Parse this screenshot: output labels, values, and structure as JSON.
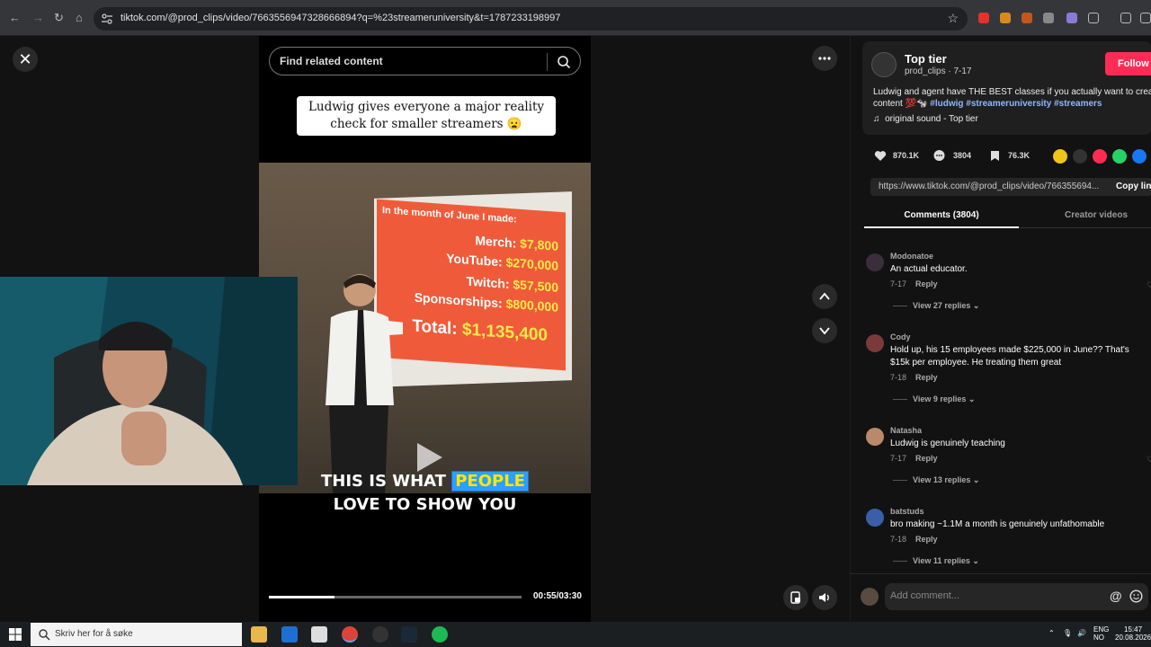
{
  "browser": {
    "url": "tiktok.com/@prod_clips/video/7663556947328666894?q=%23streameruniversity&t=1787233198997"
  },
  "search": {
    "placeholder": "Find related content"
  },
  "video": {
    "headline_line1": "Ludwig gives everyone a major reality",
    "headline_line2": "check for smaller streamers 😦",
    "slide": {
      "title": "In the month of June I made:",
      "lines": [
        {
          "label": "Merch:",
          "value": "$7,800"
        },
        {
          "label": "YouTube:",
          "value": "$270,000"
        },
        {
          "label": "Twitch:",
          "value": "$57,500"
        },
        {
          "label": "Sponsorships:",
          "value": "$800,000"
        },
        {
          "label": "Total:",
          "value": "$1,135,400"
        }
      ]
    },
    "caption_pre": "THIS IS WHAT",
    "caption_highlight": "PEOPLE",
    "caption_line2": "LOVE TO SHOW YOU",
    "time": "00:55/03:30",
    "progress": 0.26
  },
  "post": {
    "author": "Top tier",
    "handle_date": "prod_clips · 7-17",
    "follow": "Follow",
    "description": "Ludwig and agent have THE BEST classes if you actually want to create content 💯🐄",
    "tags": "#ludwig #streameruniversity #streamers",
    "sound": "original sound - Top tier",
    "likes": "870.1K",
    "comments_count": "3804",
    "saves": "76.3K",
    "link": "https://www.tiktok.com/@prod_clips/video/766355694...",
    "copy_link": "Copy link"
  },
  "tabs": {
    "comments": "Comments (3804)",
    "creator": "Creator videos"
  },
  "comments": [
    {
      "name": "Modonatoe",
      "text": "An actual educator.",
      "date": "7-17",
      "reply": "Reply",
      "replies": "View 27 replies"
    },
    {
      "name": "Cody",
      "text": "Hold up, his 15 employees made $225,000 in June?? That's $15k per employee. He treating them great",
      "date": "7-18",
      "reply": "Reply",
      "replies": "View 9 replies"
    },
    {
      "name": "Natasha",
      "text": "Ludwig is genuinely teaching",
      "date": "7-17",
      "reply": "Reply",
      "replies": "View 13 replies"
    },
    {
      "name": "batstuds",
      "text": "bro making ~1.1M a month is genuinely unfathomable",
      "date": "7-18",
      "reply": "Reply",
      "replies": "View 11 replies"
    }
  ],
  "add_comment": {
    "placeholder": "Add comment..."
  },
  "taskbar": {
    "search_placeholder": "Skriv her for å søke",
    "lang1": "ENG",
    "lang2": "NO",
    "time": "15:47",
    "date": "20.08.2026"
  },
  "colors": {
    "follow": "#fe2c55",
    "tag": "#8fb8ff",
    "slide": "#ef5b3a",
    "caption_highlight": "#2aa0ff"
  },
  "icons": [
    "close-icon",
    "search-icon",
    "more-icon",
    "chevron-up-icon",
    "chevron-down-icon",
    "play-icon",
    "pip-icon",
    "volume-icon",
    "heart-icon",
    "comment-icon",
    "bookmark-icon",
    "music-note-icon",
    "at-icon",
    "emoji-icon",
    "windows-icon"
  ]
}
